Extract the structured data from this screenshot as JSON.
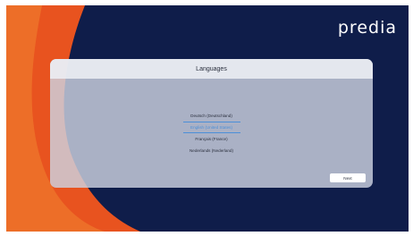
{
  "brand": {
    "logo_text": "predia"
  },
  "colors": {
    "background_navy": "#0f1d4a",
    "accent_orange": "#e8531f",
    "selected_blue": "#4c8fd8"
  },
  "dialog": {
    "title": "Languages",
    "languages": [
      {
        "label": "Deutsch (Deutschland)",
        "selected": false
      },
      {
        "label": "English (United States)",
        "selected": true
      },
      {
        "label": "Français (France)",
        "selected": false
      },
      {
        "label": "Nederlands (Nederland)",
        "selected": false
      }
    ],
    "next_label": "Next"
  }
}
